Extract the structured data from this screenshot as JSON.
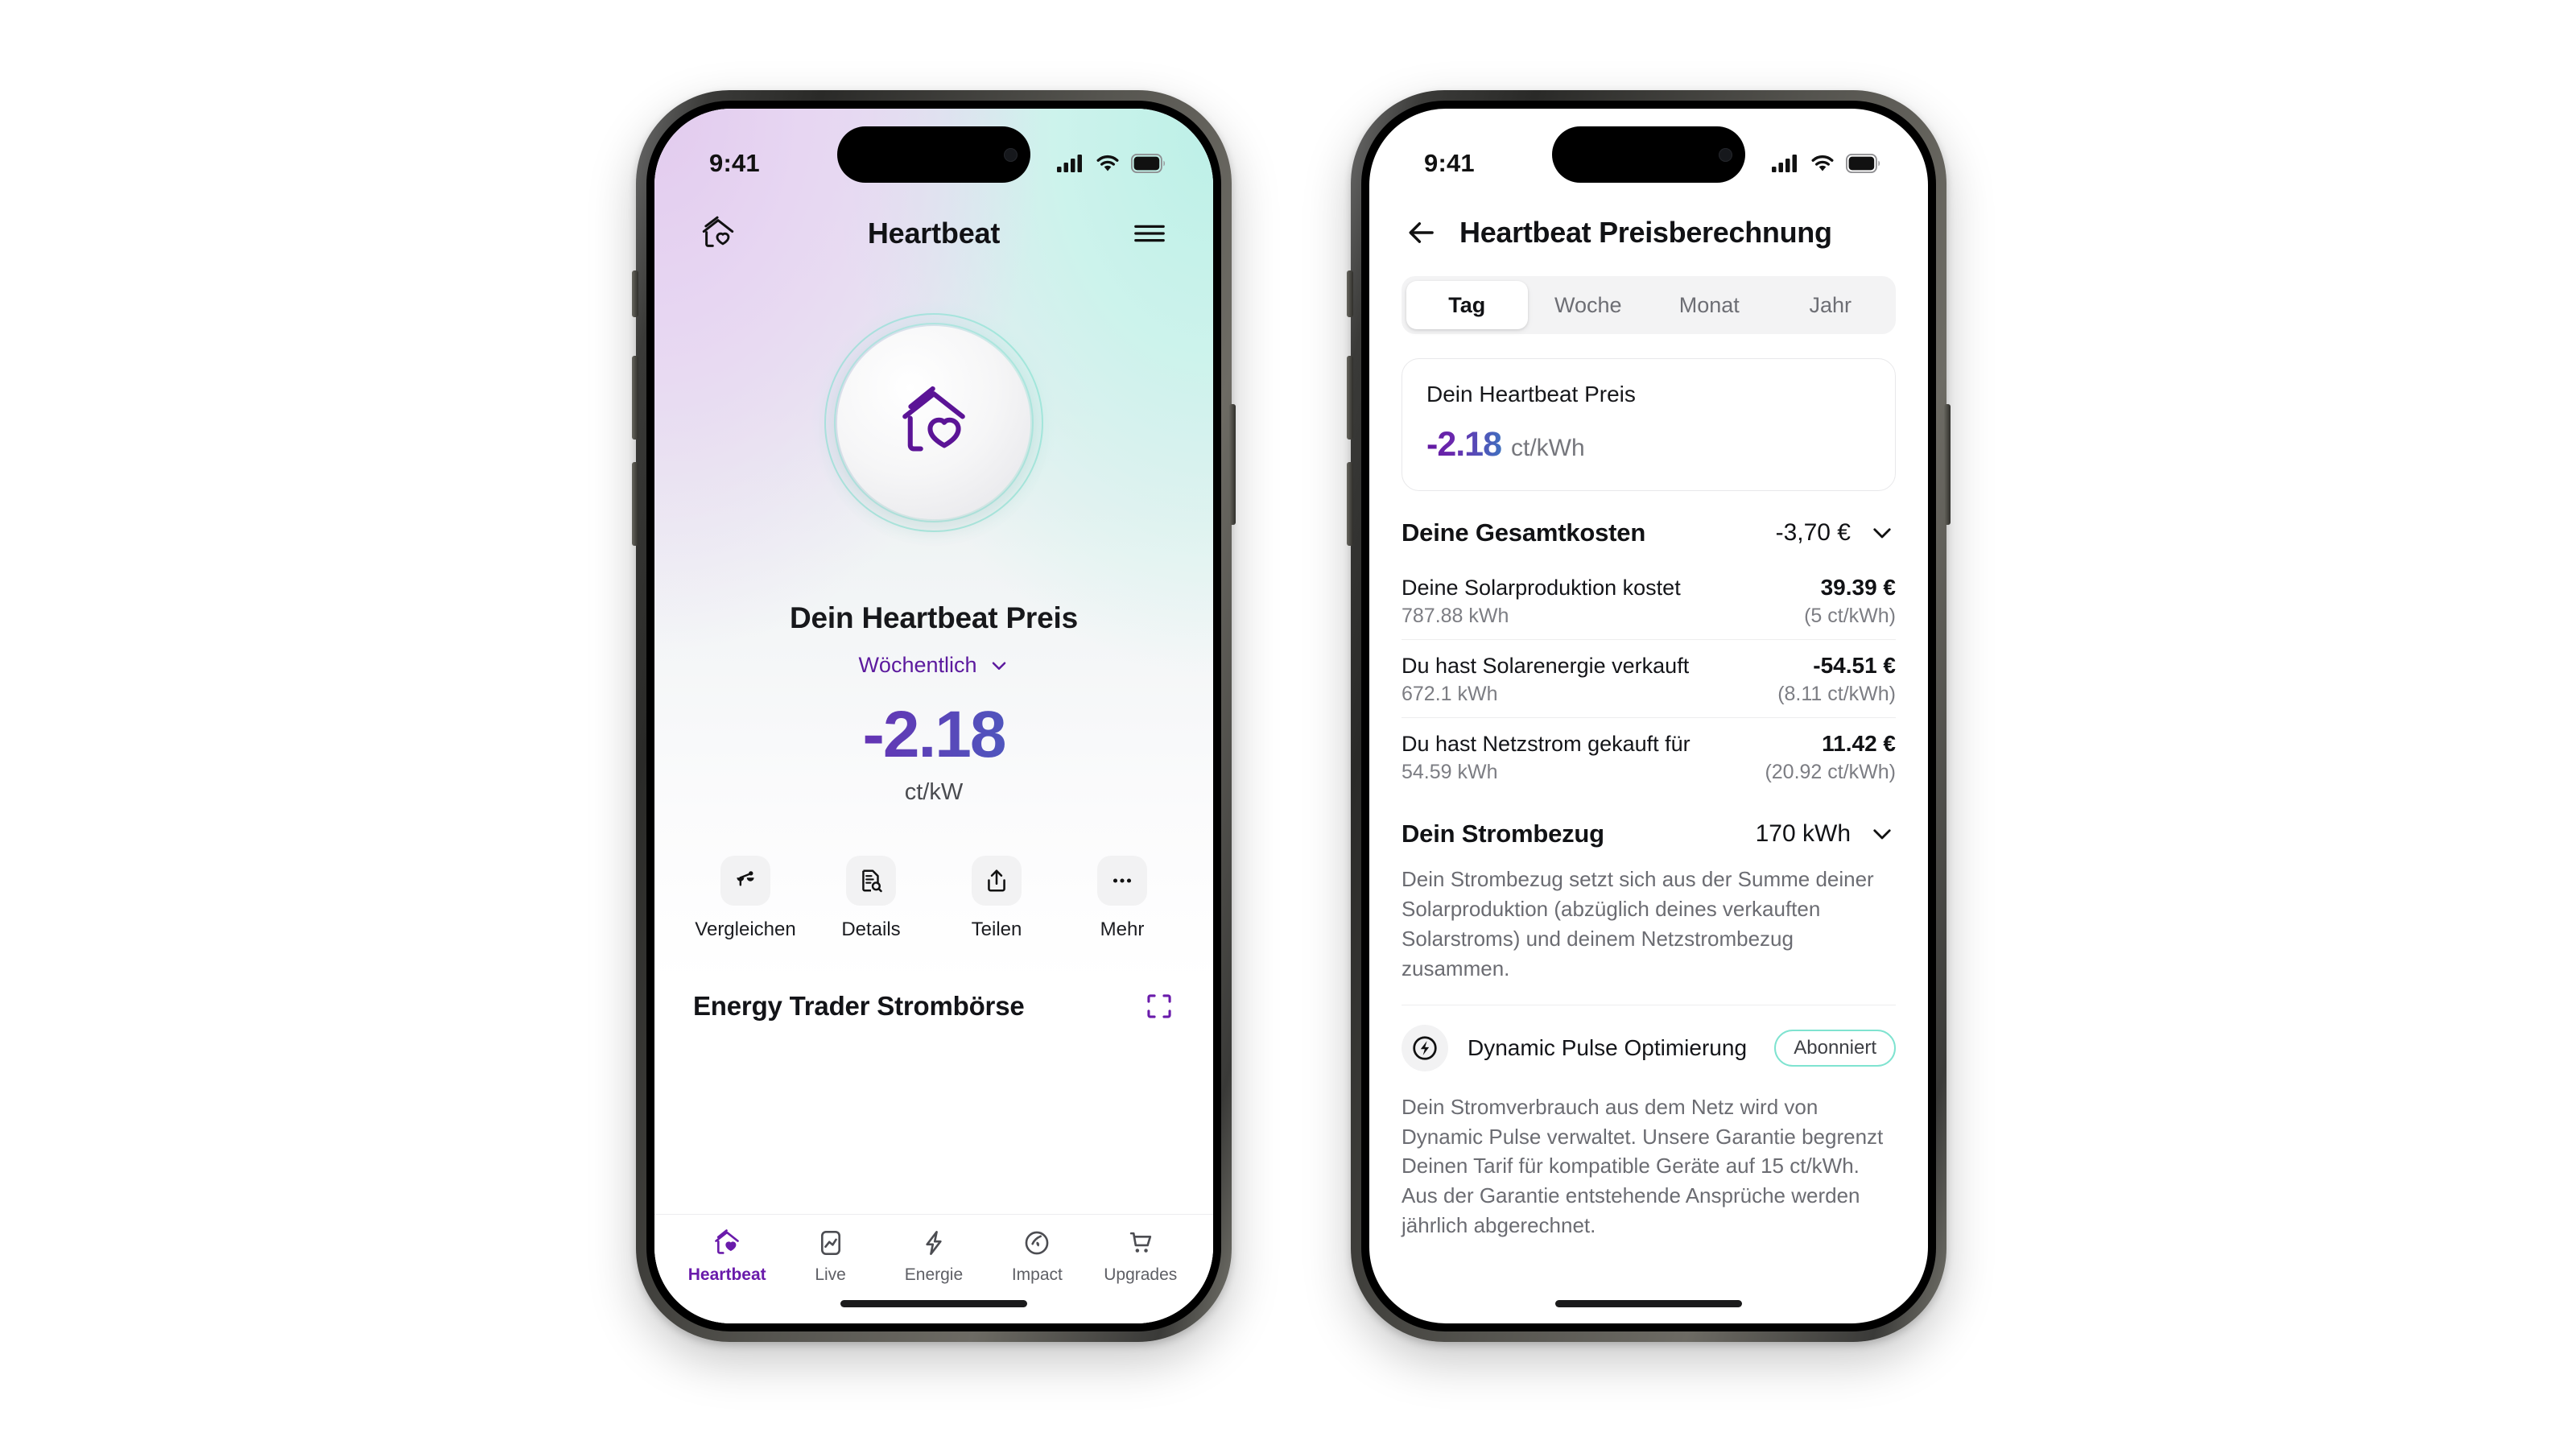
{
  "phone1": {
    "status": {
      "time": "9:41",
      "cellular_icon": "cellular-bars-icon",
      "wifi_icon": "wifi-icon",
      "battery_icon": "battery-icon"
    },
    "appbar": {
      "logo_icon": "home-heart-icon",
      "title": "Heartbeat",
      "menu_icon": "hamburger-menu-icon"
    },
    "hero": {
      "orb_icon": "home-heart-orb-icon"
    },
    "price": {
      "title": "Dein Heartbeat Preis",
      "frequency": "Wöchentlich",
      "frequency_chevron": "chevron-down-icon",
      "value": "-2.18",
      "unit": "ct/kW"
    },
    "actions": [
      {
        "label": "Vergleichen",
        "icon": "scales-compare-icon"
      },
      {
        "label": "Details",
        "icon": "document-search-icon"
      },
      {
        "label": "Teilen",
        "icon": "share-upload-icon"
      },
      {
        "label": "Mehr",
        "icon": "ellipsis-icon"
      }
    ],
    "section": {
      "title": "Energy Trader Strombörse",
      "expand_icon": "expand-fullscreen-icon"
    },
    "tabs": [
      {
        "label": "Heartbeat",
        "icon": "home-heart-filled-icon",
        "active": true
      },
      {
        "label": "Live",
        "icon": "chart-frame-icon",
        "active": false
      },
      {
        "label": "Energie",
        "icon": "lightning-bolt-icon",
        "active": false
      },
      {
        "label": "Impact",
        "icon": "globe-leaf-icon",
        "active": false
      },
      {
        "label": "Upgrades",
        "icon": "shopping-cart-icon",
        "active": false
      }
    ]
  },
  "phone2": {
    "status": {
      "time": "9:41",
      "cellular_icon": "cellular-bars-icon",
      "wifi_icon": "wifi-icon",
      "battery_icon": "battery-icon"
    },
    "nav": {
      "back_icon": "arrow-left-icon",
      "title": "Heartbeat Preisberechnung"
    },
    "segments": [
      {
        "label": "Tag",
        "active": true
      },
      {
        "label": "Woche",
        "active": false
      },
      {
        "label": "Monat",
        "active": false
      },
      {
        "label": "Jahr",
        "active": false
      }
    ],
    "price_card": {
      "label": "Dein Heartbeat Preis",
      "value": "-2.18",
      "unit": "ct/kWh"
    },
    "total_costs": {
      "title": "Deine Gesamtkosten",
      "value": "-3,70 €",
      "chevron": "chevron-down-icon"
    },
    "cost_rows": [
      {
        "label": "Deine Solarproduktion kostet",
        "amount": "39.39 €",
        "sub": "787.88 kWh",
        "rate": "(5 ct/kWh)"
      },
      {
        "label": "Du hast Solarenergie verkauft",
        "amount": "-54.51 €",
        "sub": "672.1 kWh",
        "rate": "(8.11 ct/kWh)"
      },
      {
        "label": "Du hast Netzstrom gekauft für",
        "amount": "11.42 €",
        "sub": "54.59 kWh",
        "rate": "(20.92 ct/kWh)"
      }
    ],
    "consumption": {
      "title": "Dein Strombezug",
      "value": "170 kWh",
      "chevron": "chevron-down-icon",
      "description": "Dein Strombezug setzt sich aus der Summe deiner Solarproduktion (abzüglich deines verkauften Solarstroms) und deinem Netzstrombezug zusammen."
    },
    "dynamic_pulse": {
      "icon": "lightning-circle-icon",
      "label": "Dynamic Pulse Optimierung",
      "badge": "Abonniert",
      "description": "Dein Stromverbrauch aus dem Netz wird von Dynamic Pulse verwaltet. Unsere Garantie begrenzt Deinen Tarif für kompatible Geräte auf 15 ct/kWh. Aus der Garantie entstehende Ansprüche werden jährlich abgerechnet."
    }
  },
  "colors": {
    "brand_purple": "#6a1bab",
    "accent_mint": "#7fe3d0",
    "price_gradient_start": "#61169f",
    "price_gradient_end": "#3f7fc4"
  }
}
